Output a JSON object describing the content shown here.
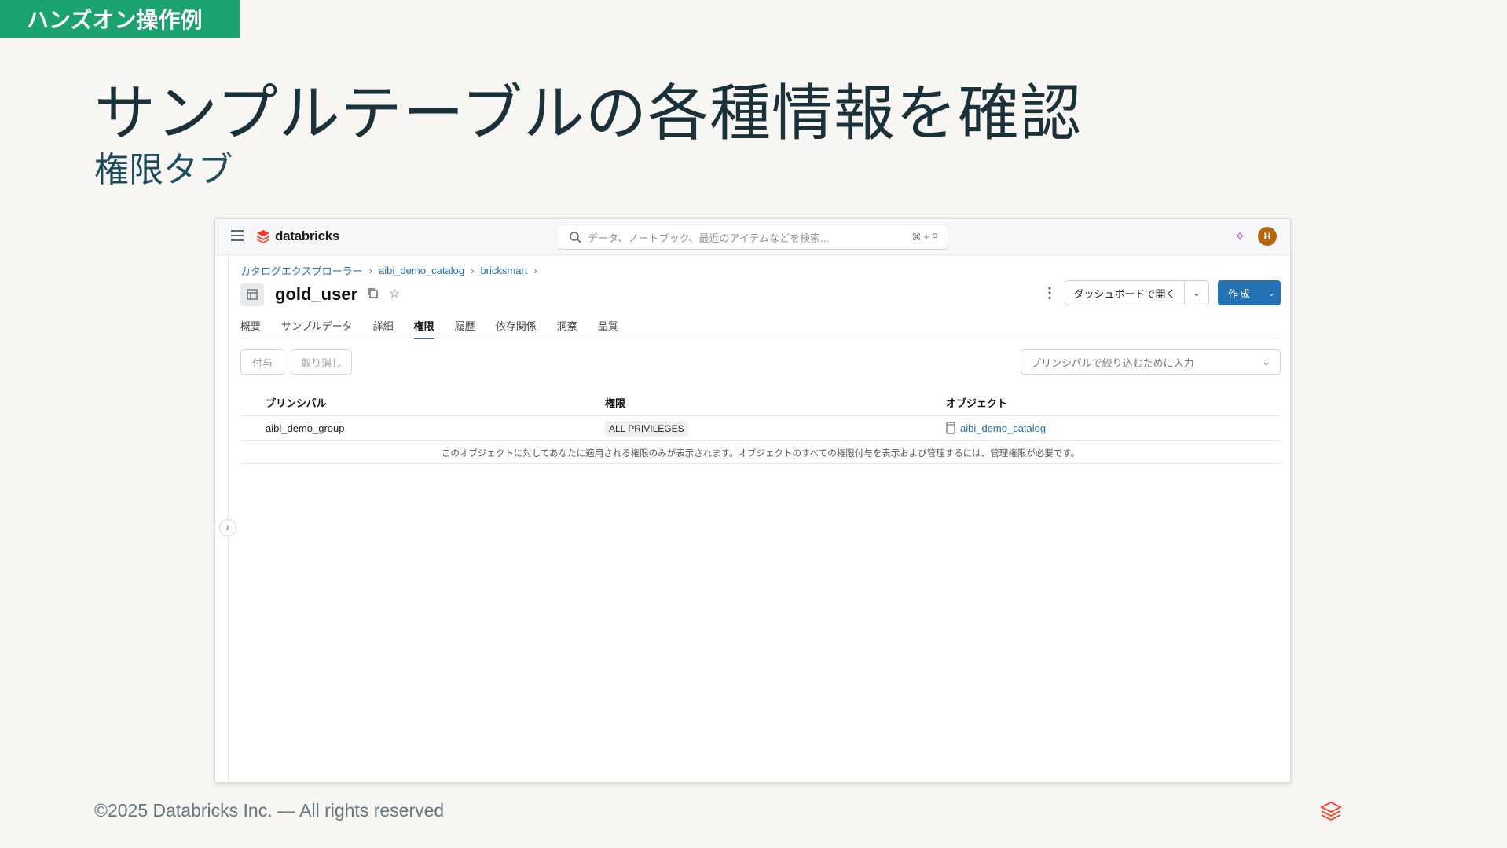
{
  "slide": {
    "badge": "ハンズオン操作例",
    "title": "サンプルテーブルの各種情報を確認",
    "subtitle": "権限タブ",
    "footer": "©2025 Databricks Inc. — All rights reserved"
  },
  "topbar": {
    "brand": "databricks",
    "search_placeholder": "データ、ノートブック、最近のアイテムなどを検索...",
    "search_shortcut": "⌘ + P",
    "avatar_initial": "H"
  },
  "breadcrumb": [
    "カタログエクスプローラー",
    "aibi_demo_catalog",
    "bricksmart"
  ],
  "table": {
    "name": "gold_user"
  },
  "actions": {
    "open_dashboard": "ダッシュボードで開く",
    "create": "作成"
  },
  "tabs": [
    "概要",
    "サンプルデータ",
    "詳細",
    "権限",
    "履歴",
    "依存関係",
    "洞察",
    "品質"
  ],
  "active_tab": "権限",
  "permissions": {
    "grant_button": "付与",
    "revoke_button": "取り消し",
    "filter_placeholder": "プリンシパルで絞り込むために入力",
    "columns": [
      "プリンシパル",
      "権限",
      "オブジェクト"
    ],
    "rows": [
      {
        "principal": "aibi_demo_group",
        "privilege": "ALL PRIVILEGES",
        "object": "aibi_demo_catalog"
      }
    ],
    "note": "このオブジェクトに対してあなたに適用される権限のみが表示されます。オブジェクトのすべての権限付与を表示および管理するには、管理権限が必要です。"
  },
  "colors": {
    "badge": "#1aa36f",
    "accent": "#2272b4",
    "avatar": "#b8650f"
  }
}
